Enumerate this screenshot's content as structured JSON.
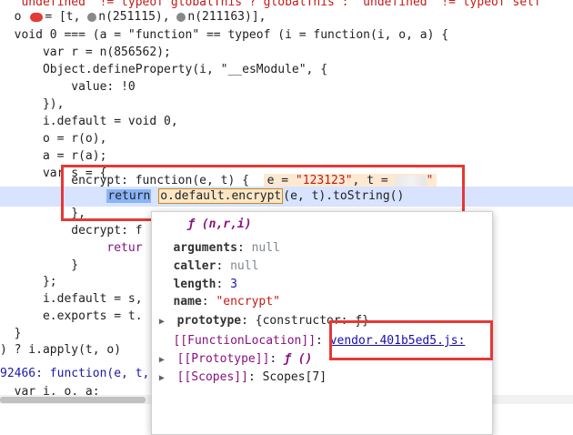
{
  "code_lines": [
    {
      "text": "  \"undefined\" != typeof globalThis ? globalThis : \"undefined\" != typeof self"
    },
    {
      "text": "= [t, ",
      "a": "n(251115), ",
      "b": "n(211163)],"
    },
    {
      "text": "void 0 === (a = \"function\" == typeof (i = function(i, o, a) {"
    },
    {
      "text": "var r = n(856562);"
    },
    {
      "text": "Object.defineProperty(i, \"__esModule\", {"
    },
    {
      "text": "value: !0"
    },
    {
      "text": "}),"
    },
    {
      "text": "i.default = void 0,"
    },
    {
      "text": "o = r(o),"
    },
    {
      "text": "a = r(a);"
    },
    {
      "text": "var s = {"
    },
    {
      "text": "encrypt: function(e, t) {"
    },
    {
      "text": "o.default.encrypt",
      "after": "(e, t).toString()"
    },
    {
      "text": "},"
    },
    {
      "text": "decrypt: f"
    },
    {
      "text": "retur"
    },
    {
      "text": "}"
    },
    {
      "text": "};"
    },
    {
      "text": "i.default = s,"
    },
    {
      "text": "e.exports = t."
    },
    {
      "text": "}"
    },
    {
      "text": ") ? i.apply(t, o)"
    },
    {
      "text": "92466: function(e, t,"
    },
    {
      "text": "var i, o, a;"
    }
  ],
  "inline_value": {
    "prefix": "e = ",
    "e_value": "\"123123\"",
    "mid": ", t = ",
    "t_suffix": "\""
  },
  "return_kw": "return",
  "popover": {
    "header": "ƒ (n,r,i)",
    "rows": [
      {
        "key": "arguments",
        "value": "null"
      },
      {
        "key": "caller",
        "value": "null"
      },
      {
        "key": "length",
        "value": "3"
      },
      {
        "key": "name",
        "value": "\"encrypt\""
      },
      {
        "key": "prototype",
        "value": "{constructor: ƒ}"
      },
      {
        "key": "[[FunctionLocation]]",
        "value": "vendor.401b5ed5.js:"
      },
      {
        "key": "[[Prototype]]",
        "value": "ƒ ()"
      },
      {
        "key": "[[Scopes]]",
        "value": "Scopes[7]"
      }
    ]
  },
  "colors": {
    "highlight_box": "#e53935",
    "active_line": "#d7e3ff"
  }
}
